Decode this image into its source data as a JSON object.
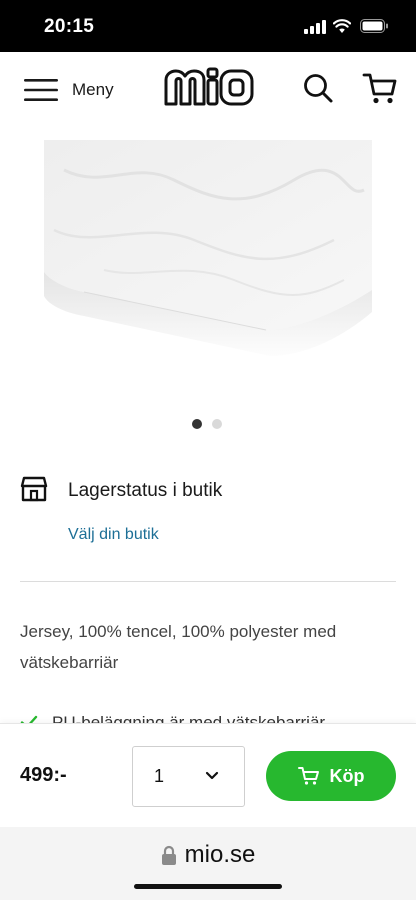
{
  "status_bar": {
    "time": "20:15"
  },
  "header": {
    "menu_label": "Meny",
    "logo_text": "miO",
    "icons": {
      "menu": "hamburger-icon",
      "search": "search-icon",
      "cart": "cart-icon"
    }
  },
  "gallery": {
    "slide_count": 2,
    "active_index": 0
  },
  "store": {
    "icon": "store-icon",
    "title": "Lagerstatus i butik",
    "link": "Välj din butik"
  },
  "description": "Jersey, 100% tencel, 100% polyester med vätskebarriär",
  "features": [
    {
      "icon": "check-icon",
      "text": "PU-beläggning är med vätskebarriär"
    }
  ],
  "purchase": {
    "price": "499:-",
    "quantity": "1",
    "buy_label": "Köp",
    "buy_icon": "cart-icon"
  },
  "browser": {
    "url": "mio.se",
    "icon": "lock-icon"
  },
  "colors": {
    "accent_green": "#27b82f",
    "link_blue": "#1d6f96",
    "text": "#1a1a1a",
    "divider": "#dcdcdc"
  }
}
